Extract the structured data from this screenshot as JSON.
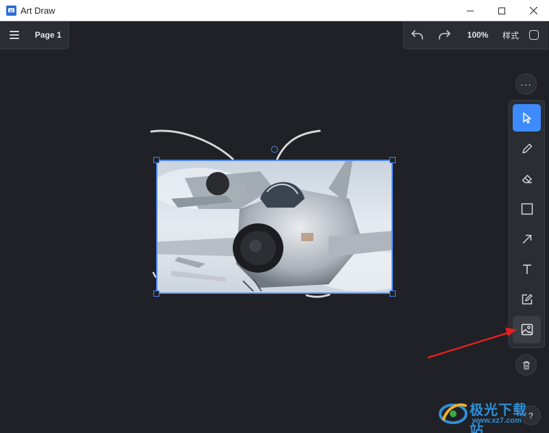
{
  "window": {
    "title": "Art Draw",
    "controls": [
      "minimize",
      "maximize",
      "close"
    ]
  },
  "page_panel": {
    "menu_icon": "hamburger-icon",
    "page_label": "Page 1"
  },
  "top_toolbar": {
    "undo_icon": "undo-icon",
    "redo_icon": "redo-icon",
    "zoom": "100%",
    "style_label": "样式"
  },
  "canvas": {
    "background": "#1f2126",
    "selection_color": "#4a86f0",
    "image_description_icon": "fighter-jet-photo"
  },
  "tools": [
    {
      "name": "select",
      "icon": "cursor-icon",
      "active": true
    },
    {
      "name": "pencil",
      "icon": "pencil-icon",
      "active": false
    },
    {
      "name": "eraser",
      "icon": "eraser-icon",
      "active": false
    },
    {
      "name": "rectangle",
      "icon": "rectangle-icon",
      "active": false
    },
    {
      "name": "arrow",
      "icon": "arrow-icon",
      "active": false
    },
    {
      "name": "text",
      "icon": "text-icon",
      "active": false
    },
    {
      "name": "note",
      "icon": "edit-note-icon",
      "active": false
    },
    {
      "name": "image",
      "icon": "image-icon",
      "active": false,
      "hovered": true
    }
  ],
  "side_buttons": {
    "more": "···",
    "help": "?"
  },
  "accent_color": "#3d8bff",
  "annotation_arrow_color": "#e0201e",
  "watermark": {
    "text": "极光下载站",
    "url": "www.xz7.com"
  }
}
